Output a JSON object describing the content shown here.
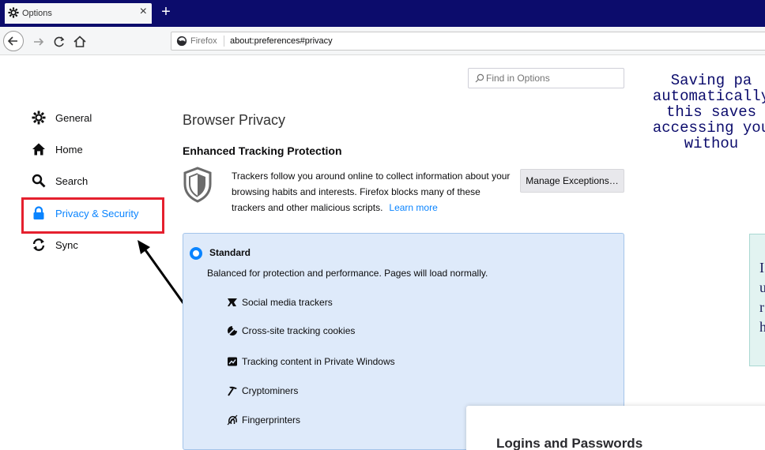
{
  "tab": {
    "title": "Options",
    "close": "×",
    "new_tab": "+"
  },
  "urlbar": {
    "identity": "Firefox",
    "url": "about:preferences#privacy"
  },
  "find": {
    "placeholder": "Find in Options"
  },
  "sidebar": {
    "items": [
      {
        "label": "General",
        "icon": "gear-icon"
      },
      {
        "label": "Home",
        "icon": "home-icon"
      },
      {
        "label": "Search",
        "icon": "search-icon"
      },
      {
        "label": "Privacy & Security",
        "icon": "lock-icon",
        "selected": true
      },
      {
        "label": "Sync",
        "icon": "sync-icon"
      }
    ]
  },
  "main": {
    "page_title": "Browser Privacy",
    "etp": {
      "title": "Enhanced Tracking Protection",
      "description": "Trackers follow you around online to collect information about your browsing habits and interests. Firefox blocks many of these trackers and other malicious scripts.",
      "learn_more": "Learn more",
      "manage_button": "Manage Exceptions…"
    },
    "standard": {
      "label": "Standard",
      "description": "Balanced for protection and performance. Pages will load normally.",
      "trackers": [
        {
          "label": "Social media trackers",
          "icon": "social-tracker-icon"
        },
        {
          "label": "Cross-site tracking cookies",
          "icon": "cookie-icon"
        },
        {
          "label": "Tracking content in Private Windows",
          "icon": "tracking-content-icon"
        },
        {
          "label": "Cryptominers",
          "icon": "cryptominer-icon"
        },
        {
          "label": "Fingerprinters",
          "icon": "fingerprinter-icon"
        }
      ]
    }
  },
  "overlay": {
    "tutorial_lines": [
      "Saving pa",
      "automatically",
      "this saves",
      "accessing you",
      "withou"
    ],
    "tip_lines": [
      "I",
      "u",
      "r",
      "h"
    ],
    "logins_title": "Logins and Passwords"
  },
  "colors": {
    "accent": "#0a84ff",
    "highlight": "#e5202e",
    "titlebar": "#0c0c6c",
    "standard_bg": "#deeafa"
  }
}
